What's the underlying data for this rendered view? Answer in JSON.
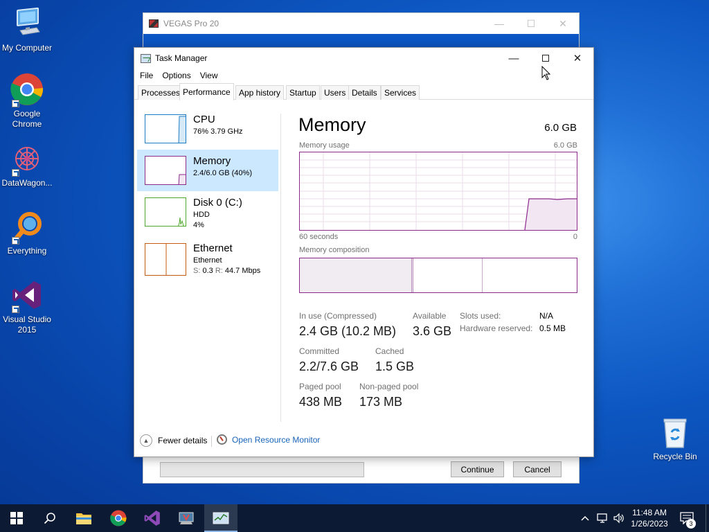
{
  "desktop": {
    "icons": [
      {
        "label": "My Computer"
      },
      {
        "label": "Google Chrome"
      },
      {
        "label": "DataWagon..."
      },
      {
        "label": "Everything"
      },
      {
        "label": "Visual Studio 2015"
      },
      {
        "label": "Recycle Bin"
      }
    ]
  },
  "vegas": {
    "title": "VEGAS Pro 20",
    "continue_label": "Continue",
    "cancel_label": "Cancel",
    "progress": 0
  },
  "taskmanager": {
    "title": "Task Manager",
    "menu": [
      "File",
      "Options",
      "View"
    ],
    "tabs": [
      "Processes",
      "Performance",
      "App history",
      "Startup",
      "Users",
      "Details",
      "Services"
    ],
    "active_tab": "Performance",
    "sidebar": [
      {
        "name": "CPU",
        "sub1": "76%  3.79 GHz"
      },
      {
        "name": "Memory",
        "sub1": "2.4/6.0 GB (40%)"
      },
      {
        "name": "Disk 0 (C:)",
        "sub1": "HDD",
        "sub2": "4%"
      },
      {
        "name": "Ethernet",
        "sub1": "Ethernet",
        "sub2_label_s": "S:",
        "sub2_val_s": "0.3",
        "sub2_label_r": "R:",
        "sub2_val_r": "44.7 Mbps"
      }
    ],
    "detail": {
      "title": "Memory",
      "total": "6.0 GB",
      "usage_label": "Memory usage",
      "usage_max": "6.0 GB",
      "time_left": "60 seconds",
      "time_right": "0",
      "composition_label": "Memory composition",
      "stats": {
        "in_use_label": "In use (Compressed)",
        "in_use_value": "2.4 GB (10.2 MB)",
        "available_label": "Available",
        "available_value": "3.6 GB",
        "slots_label": "Slots used:",
        "slots_value": "N/A",
        "hw_reserved_label": "Hardware reserved:",
        "hw_reserved_value": "0.5 MB",
        "committed_label": "Committed",
        "committed_value": "2.2/7.6 GB",
        "cached_label": "Cached",
        "cached_value": "1.5 GB",
        "paged_label": "Paged pool",
        "paged_value": "438 MB",
        "nonpaged_label": "Non-paged pool",
        "nonpaged_value": "173 MB"
      }
    },
    "fewer_details": "Fewer details",
    "open_resource_monitor": "Open Resource Monitor"
  },
  "taskbar": {
    "time": "11:48 AM",
    "date": "1/26/2023",
    "notification_count": "3"
  },
  "colors": {
    "memory_accent": "#8b2a8b",
    "cpu_accent": "#1e7cc4",
    "disk_accent": "#4ea72e",
    "ethernet_accent": "#c25a12",
    "link": "#1a63b8"
  }
}
